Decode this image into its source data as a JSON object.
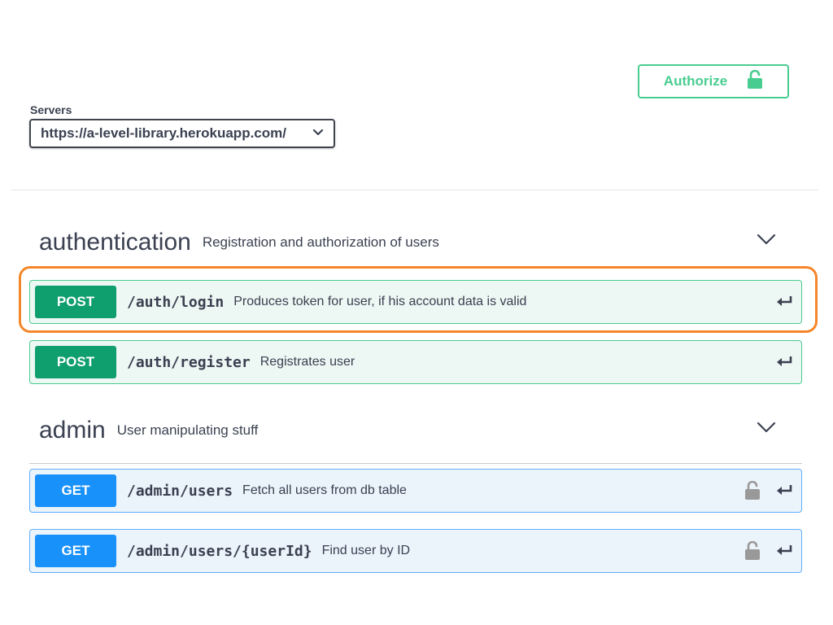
{
  "header": {
    "authorize_label": "Authorize",
    "colors": {
      "authorize": "#49cc90"
    }
  },
  "servers": {
    "label": "Servers",
    "selected": "https://a-level-library.herokuapp.com/"
  },
  "tags": [
    {
      "name": "authentication",
      "description": "Registration and authorization of users",
      "operations": [
        {
          "method": "POST",
          "path": "/auth/login",
          "summary": "Produces token for user, if his account data is valid",
          "locked": false
        },
        {
          "method": "POST",
          "path": "/auth/register",
          "summary": "Registrates user",
          "locked": false
        }
      ]
    },
    {
      "name": "admin",
      "description": "User manipulating stuff",
      "operations": [
        {
          "method": "GET",
          "path": "/admin/users",
          "summary": "Fetch all users from db table",
          "locked": true
        },
        {
          "method": "GET",
          "path": "/admin/users/{userId}",
          "summary": "Find user by ID",
          "locked": true
        }
      ]
    }
  ],
  "icons": {
    "authorize": "unlock-icon",
    "server_dropdown": "chevron-down-icon",
    "tag_toggle": "chevron-down-icon",
    "operation_lock": "unlock-icon",
    "operation_expand": "enter-arrow-icon"
  },
  "colors": {
    "post_bg": "#edf7f3",
    "post_border": "#49cc90",
    "post_badge": "#0f9e6e",
    "get_bg": "#ebf3fb",
    "get_border": "#61affe",
    "get_badge": "#1891fa",
    "highlight": "#f5862a"
  }
}
